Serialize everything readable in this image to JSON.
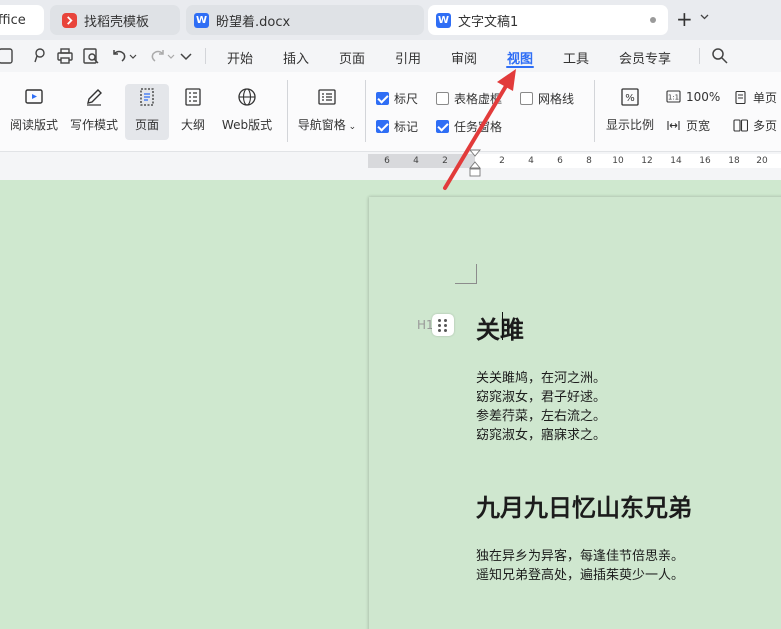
{
  "tabs": [
    {
      "label": "ffice"
    },
    {
      "label": "找稻壳模板"
    },
    {
      "label": "盼望着.docx"
    },
    {
      "label": "文字文稿1"
    }
  ],
  "tab_icon_letter": "W",
  "new_tab": "+",
  "menu": [
    "开始",
    "插入",
    "页面",
    "引用",
    "审阅",
    "视图",
    "工具",
    "会员专享"
  ],
  "active_menu": "视图",
  "ribbon": {
    "views": [
      "阅读版式",
      "写作模式",
      "页面",
      "大纲",
      "Web版式"
    ],
    "nav_pane": "导航窗格",
    "checkboxes": [
      {
        "label": "标尺",
        "checked": true
      },
      {
        "label": "表格虚框",
        "checked": false
      },
      {
        "label": "网格线",
        "checked": false
      },
      {
        "label": "标记",
        "checked": true
      },
      {
        "label": "任务窗格",
        "checked": true
      }
    ],
    "zoom": "显示比例",
    "zoom_100": "100%",
    "page_width": "页宽",
    "single_page": "单页",
    "multi_page": "多页"
  },
  "ruler_ticks": [
    "6",
    "4",
    "2",
    "2",
    "2",
    "4",
    "6",
    "8",
    "10",
    "12",
    "14",
    "16",
    "18",
    "20"
  ],
  "document": {
    "heading_marker": "H1",
    "heading1": "关雎",
    "para1": [
      "关关雎鸠，在河之洲。",
      "窈窕淑女，君子好逑。",
      "参差荇菜，左右流之。",
      "窈窕淑女，寤寐求之。"
    ],
    "heading2": "九月九日忆山东兄弟",
    "para2": [
      "独在异乡为异客，每逢佳节倍思亲。",
      "遥知兄弟登高处，遍插茱萸少一人。"
    ]
  },
  "colors": {
    "accent": "#2f6ef5",
    "arrow": "#e23b3b",
    "page_bg": "#cfe8cf"
  }
}
